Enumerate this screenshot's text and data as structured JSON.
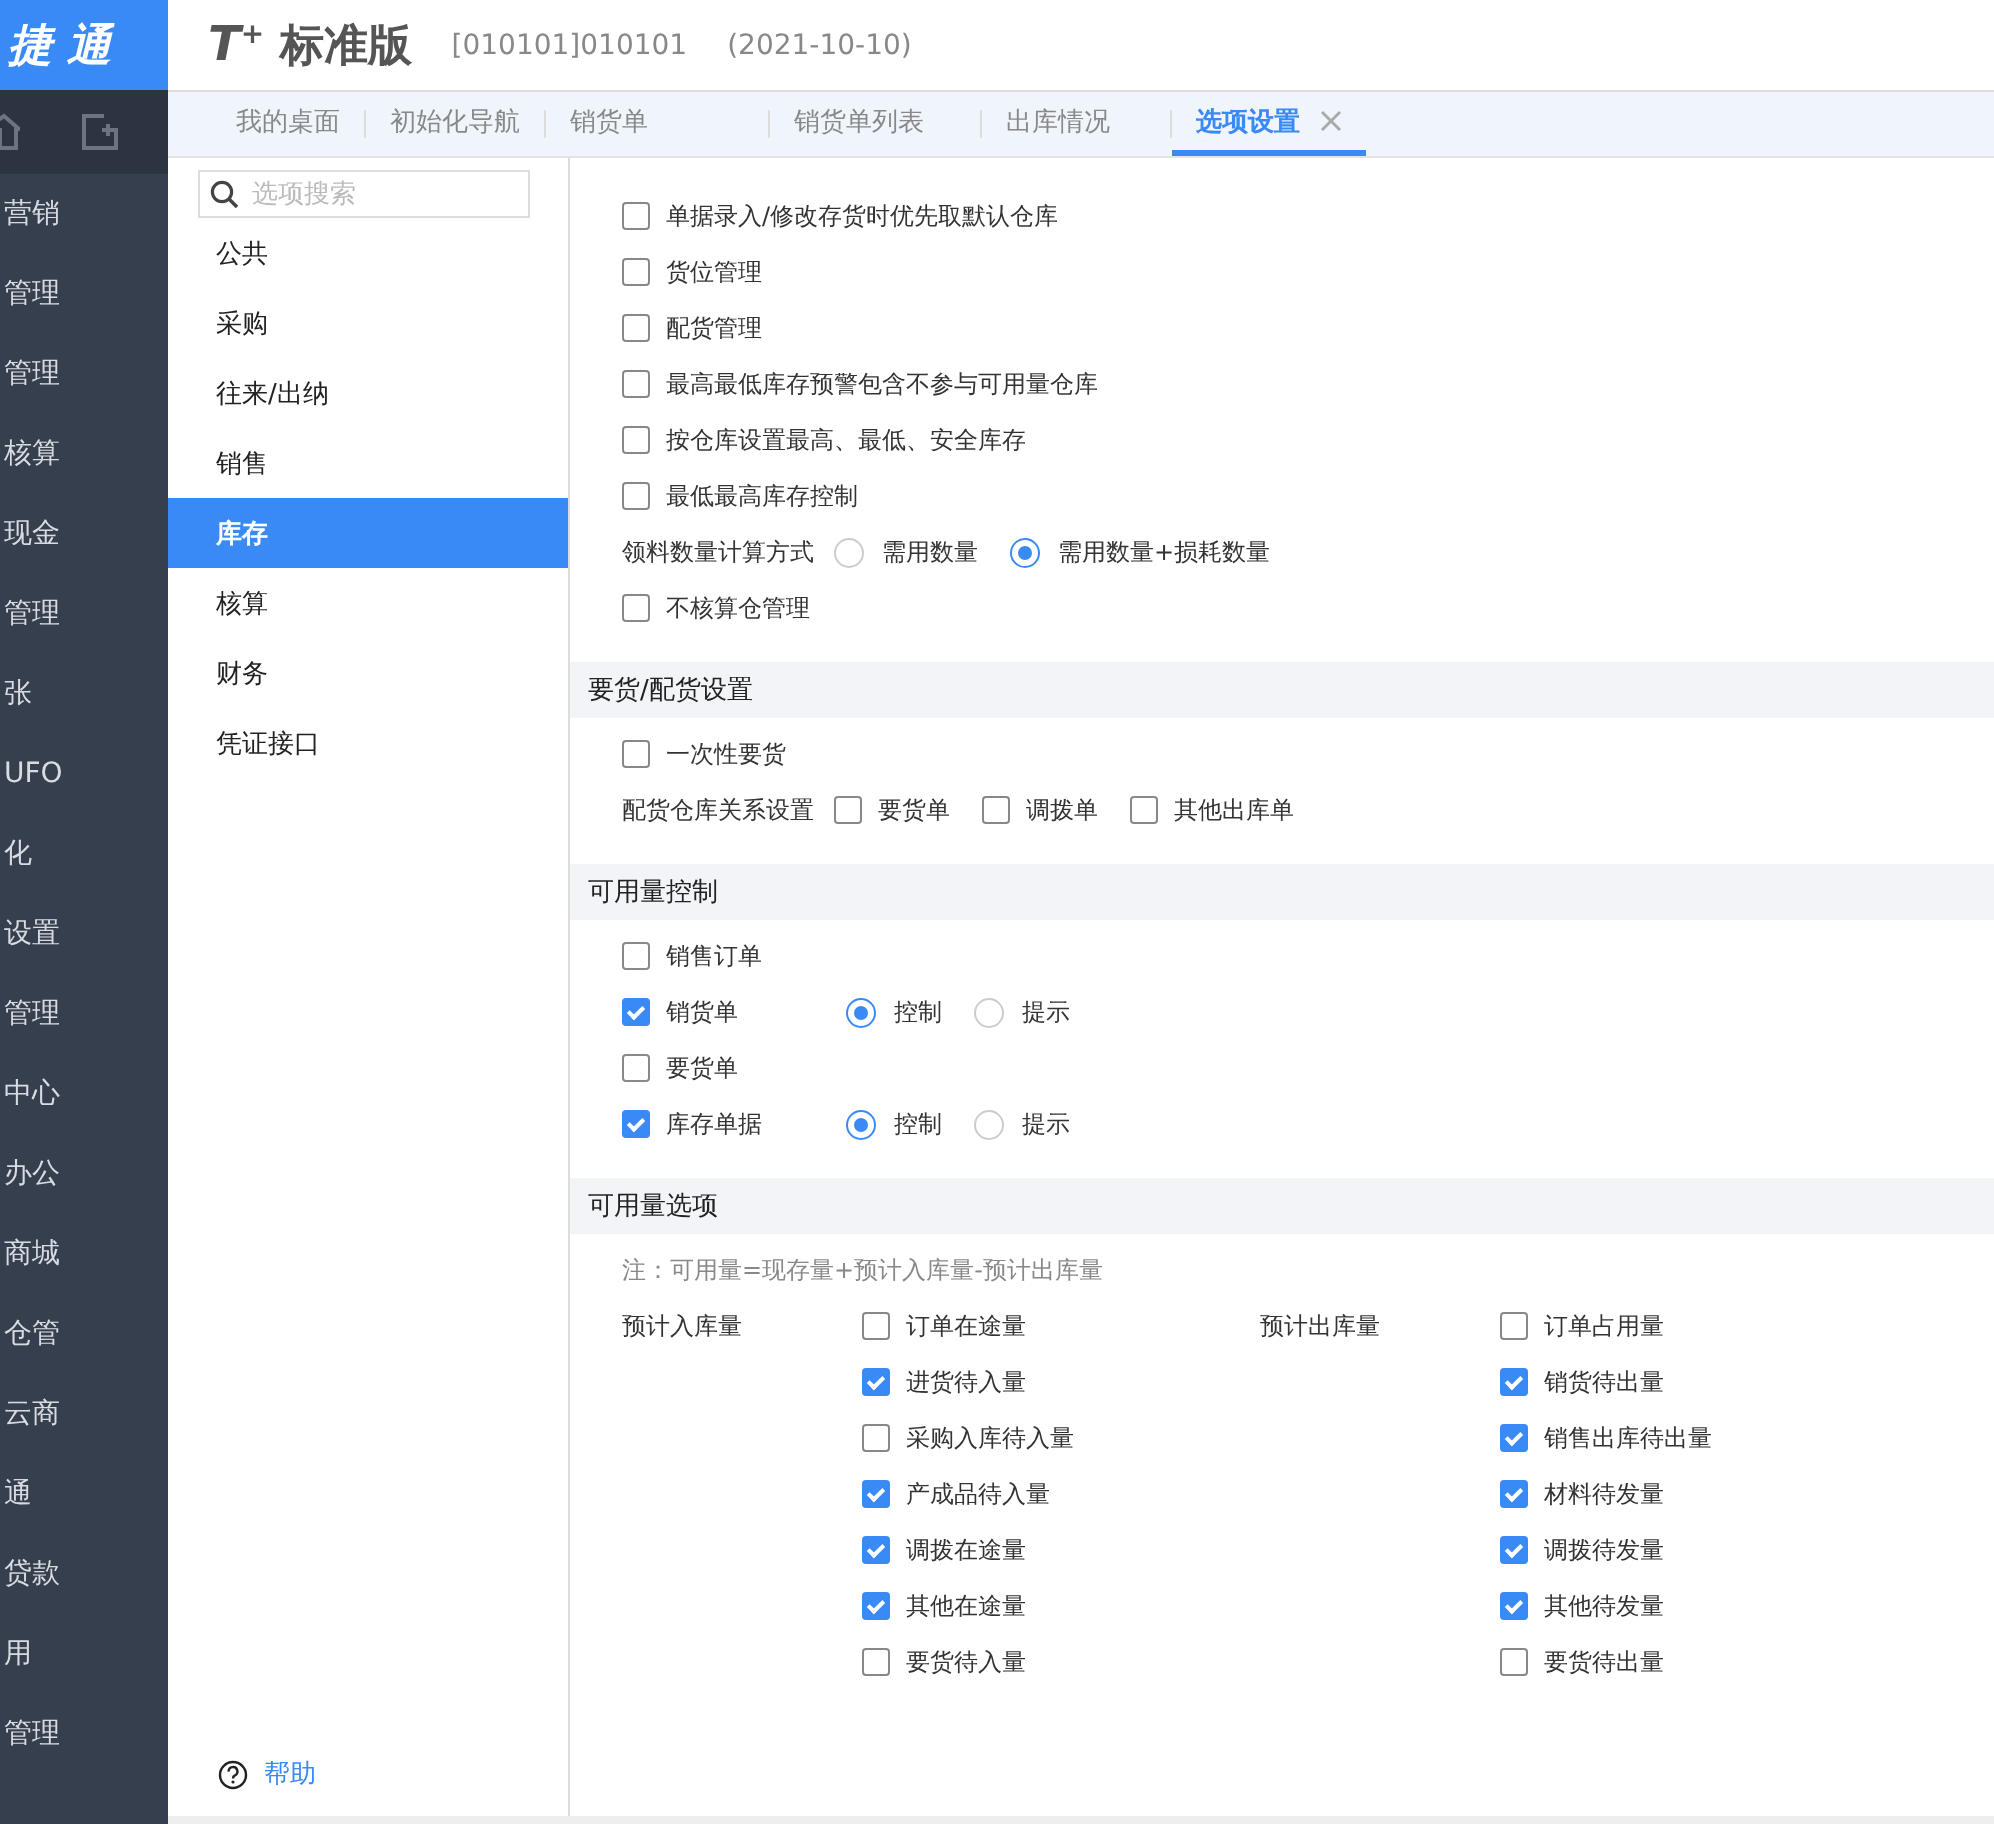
{
  "brand": {
    "logo": "捷 通",
    "mark": "T",
    "mark_sup": "+",
    "product": "标准版",
    "account": "[010101]010101",
    "date": "(2021-10-10)"
  },
  "nav": {
    "items": [
      "营销",
      "管理",
      "管理",
      "核算",
      "现金",
      "管理",
      "张",
      "UFO",
      "化",
      "设置",
      "管理",
      "中心",
      "办公",
      "商城",
      "仓管",
      "云商",
      "通",
      "贷款",
      "用",
      "管理"
    ]
  },
  "tabs": [
    {
      "label": "我的桌面",
      "selected": false,
      "closable": false
    },
    {
      "label": "初始化导航",
      "selected": false,
      "closable": false
    },
    {
      "label": "销货单",
      "selected": false,
      "closable": false
    },
    {
      "label": "销货单列表",
      "selected": false,
      "closable": false
    },
    {
      "label": "出库情况",
      "selected": false,
      "closable": false
    },
    {
      "label": "选项设置",
      "selected": true,
      "closable": true
    }
  ],
  "options_sidebar": {
    "search_placeholder": "选项搜索",
    "items": [
      {
        "label": "公共",
        "selected": false
      },
      {
        "label": "采购",
        "selected": false
      },
      {
        "label": "往来/出纳",
        "selected": false
      },
      {
        "label": "销售",
        "selected": false
      },
      {
        "label": "库存",
        "selected": true
      },
      {
        "label": "核算",
        "selected": false
      },
      {
        "label": "财务",
        "selected": false
      },
      {
        "label": "凭证接口",
        "selected": false
      }
    ],
    "help": "帮助"
  },
  "sections": [
    {
      "rows": [
        {
          "kind": "checkbox",
          "label": "单据录入/修改存货时优先取默认仓库",
          "checked": false
        },
        {
          "kind": "checkbox",
          "label": "货位管理",
          "checked": false
        },
        {
          "kind": "checkbox",
          "label": "配货管理",
          "checked": false
        },
        {
          "kind": "checkbox",
          "label": "最高最低库存预警包含不参与可用量仓库",
          "checked": false
        },
        {
          "kind": "checkbox",
          "label": "按仓库设置最高、最低、安全库存",
          "checked": false
        },
        {
          "kind": "checkbox",
          "label": "最低最高库存控制",
          "checked": false
        },
        {
          "kind": "radios",
          "label": "领料数量计算方式",
          "options": [
            {
              "label": "需用数量",
              "selected": false
            },
            {
              "label": "需用数量+损耗数量",
              "selected": true
            }
          ]
        },
        {
          "kind": "checkbox",
          "label": "不核算仓管理",
          "checked": false
        }
      ]
    },
    {
      "title": "要货/配货设置",
      "rows": [
        {
          "kind": "checkbox",
          "label": "一次性要货",
          "checked": false
        },
        {
          "kind": "checks",
          "label": "配货仓库关系设置",
          "options": [
            {
              "label": "要货单",
              "checked": false
            },
            {
              "label": "调拨单",
              "checked": false
            },
            {
              "label": "其他出库单",
              "checked": false
            }
          ]
        }
      ]
    },
    {
      "title": "可用量控制",
      "rows": [
        {
          "kind": "checkbox",
          "label": "销售订单",
          "checked": false
        },
        {
          "kind": "check_radios",
          "label": "销货单",
          "checked": true,
          "options": [
            {
              "label": "控制",
              "selected": true
            },
            {
              "label": "提示",
              "selected": false
            }
          ]
        },
        {
          "kind": "checkbox",
          "label": "要货单",
          "checked": false
        },
        {
          "kind": "check_radios",
          "label": "库存单据",
          "checked": true,
          "options": [
            {
              "label": "控制",
              "selected": true
            },
            {
              "label": "提示",
              "selected": false
            }
          ]
        }
      ]
    },
    {
      "title": "可用量选项",
      "rows": [
        {
          "kind": "note",
          "text": "注：可用量=现存量+预计入库量-预计出库量"
        },
        {
          "kind": "columns",
          "groups": [
            {
              "label": "预计入库量",
              "options": [
                {
                  "label": "订单在途量",
                  "checked": false
                },
                {
                  "label": "进货待入量",
                  "checked": true
                },
                {
                  "label": "采购入库待入量",
                  "checked": false
                },
                {
                  "label": "产成品待入量",
                  "checked": true
                },
                {
                  "label": "调拨在途量",
                  "checked": true
                },
                {
                  "label": "其他在途量",
                  "checked": true
                },
                {
                  "label": "要货待入量",
                  "checked": false
                }
              ]
            },
            {
              "label": "预计出库量",
              "options": [
                {
                  "label": "订单占用量",
                  "checked": false
                },
                {
                  "label": "销货待出量",
                  "checked": true
                },
                {
                  "label": "销售出库待出量",
                  "checked": true
                },
                {
                  "label": "材料待发量",
                  "checked": true
                },
                {
                  "label": "调拨待发量",
                  "checked": true
                },
                {
                  "label": "其他待发量",
                  "checked": true
                },
                {
                  "label": "要货待出量",
                  "checked": false
                }
              ]
            }
          ]
        }
      ]
    }
  ]
}
